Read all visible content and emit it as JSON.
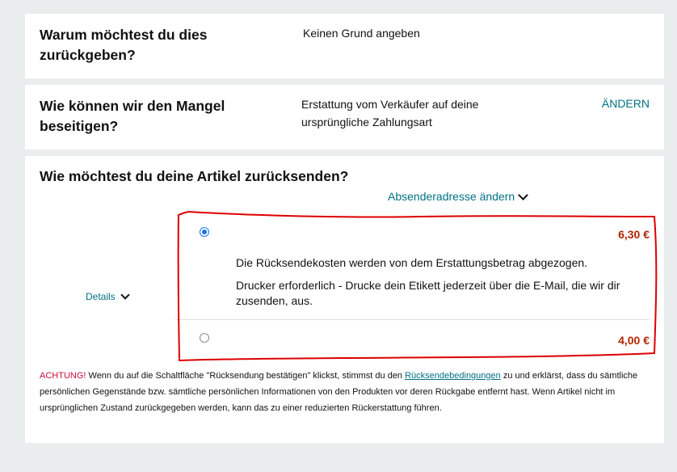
{
  "reason": {
    "question": "Warum möchtest du dies zurückgeben?",
    "answer": "Keinen Grund angeben"
  },
  "resolution": {
    "question": "Wie können wir den Mangel beseitigen?",
    "answer": "Erstattung vom Verkäufer auf deine ursprüngliche Zahlungsart",
    "change_label": "ÄNDERN"
  },
  "shipping": {
    "question": "Wie möchtest du deine Artikel zurücksenden?",
    "sender_address_link": "Absenderadresse ändern",
    "details_label": "Details",
    "options": [
      {
        "price": "6,30 €",
        "selected": true,
        "cost_note": "Die Rücksendekosten werden von dem Erstattungsbetrag abgezogen.",
        "printer_note": "Drucker erforderlich - Drucke dein Etikett jederzeit über die E-Mail, die wir dir zusenden, aus."
      },
      {
        "price": "4,00 €",
        "selected": false
      }
    ]
  },
  "warning": {
    "label": "ACHTUNG!",
    "text_before": " Wenn du auf die Schaltfläche \"Rücksendung bestätigen\" klickst, stimmst du den ",
    "link": "Rücksendebedingungen",
    "text_after": " zu und erklärst, dass du sämtliche persönlichen Gegenstände bzw. sämtliche persönlichen Informationen von den Produkten vor deren Rückgabe entfernt hast. Wenn Artikel nicht im ursprünglichen Zustand zurückgegeben werden, kann das zu einer reduzierten Rückerstattung führen."
  },
  "colors": {
    "link": "#007185",
    "price": "#b12704",
    "warning": "#cc0c39",
    "annotation": "#dd0000"
  }
}
